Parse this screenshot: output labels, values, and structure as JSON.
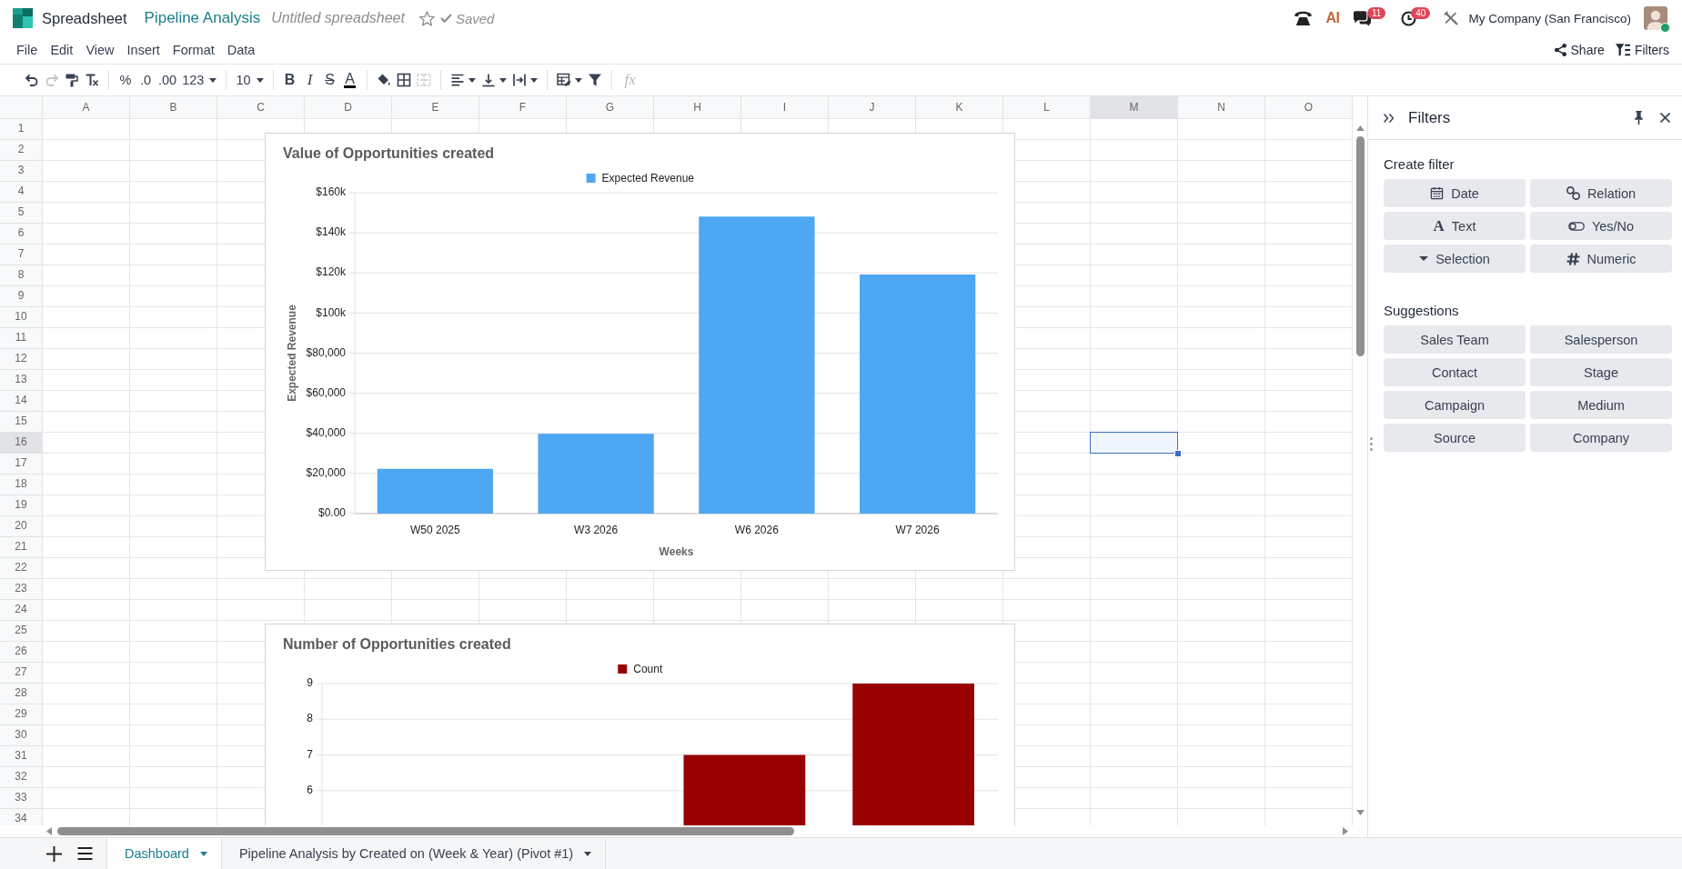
{
  "navbar": {
    "app_name": "Spreadsheet",
    "breadcrumb": "Pipeline Analysis",
    "document_name": "Untitled spreadsheet",
    "starred": false,
    "save_status": "Saved",
    "ai_label": "AI",
    "chat_badge": "11",
    "activity_badge": "40",
    "company": "My Company (San Francisco)",
    "user_online": true
  },
  "menubar": {
    "menus": [
      "File",
      "Edit",
      "View",
      "Insert",
      "Format",
      "Data"
    ],
    "actions": [
      "Share",
      "Filters"
    ]
  },
  "toolbar": [
    [
      {
        "kind": "icon",
        "disabled": false
      },
      {
        "kind": "icon",
        "disabled": true
      },
      {
        "kind": "icon",
        "disabled": false
      },
      {
        "kind": "icon",
        "disabled": false
      }
    ],
    [
      {
        "kind": "text",
        "label": "%",
        "disabled": false
      },
      {
        "kind": "text",
        "label": ".0",
        "disabled": false
      },
      {
        "kind": "text",
        "label": ".00",
        "disabled": false
      },
      {
        "kind": "menu",
        "label": "123",
        "disabled": false
      }
    ],
    [
      {
        "kind": "menu",
        "label": "10",
        "disabled": false
      }
    ],
    [
      {
        "kind": "bold",
        "label": "B",
        "disabled": false
      },
      {
        "kind": "italic",
        "label": "I",
        "disabled": false
      },
      {
        "kind": "strike",
        "label": "S",
        "disabled": false
      },
      {
        "kind": "color",
        "label": "A",
        "disabled": false
      }
    ],
    [
      {
        "kind": "icon",
        "disabled": false
      },
      {
        "kind": "icon",
        "disabled": false
      },
      {
        "kind": "icon",
        "disabled": true
      }
    ],
    [
      {
        "kind": "iconmenu",
        "disabled": false
      },
      {
        "kind": "iconmenu",
        "disabled": false
      },
      {
        "kind": "iconmenu",
        "disabled": false
      }
    ],
    [
      {
        "kind": "iconmenu",
        "disabled": false
      },
      {
        "kind": "icon",
        "disabled": false
      }
    ]
  ],
  "formula_bar": {
    "label": "fx"
  },
  "grid": {
    "columns": [
      {
        "label": "A",
        "selected": false
      },
      {
        "label": "B",
        "selected": false
      },
      {
        "label": "C",
        "selected": false
      },
      {
        "label": "D",
        "selected": false
      },
      {
        "label": "E",
        "selected": false
      },
      {
        "label": "F",
        "selected": false
      },
      {
        "label": "G",
        "selected": false
      },
      {
        "label": "H",
        "selected": false
      },
      {
        "label": "I",
        "selected": false
      },
      {
        "label": "J",
        "selected": false
      },
      {
        "label": "K",
        "selected": false
      },
      {
        "label": "L",
        "selected": false
      },
      {
        "label": "M",
        "selected": true
      },
      {
        "label": "N",
        "selected": false
      },
      {
        "label": "O",
        "selected": false
      }
    ],
    "rows": [
      {
        "label": "1",
        "selected": false
      },
      {
        "label": "2",
        "selected": false
      },
      {
        "label": "3",
        "selected": false
      },
      {
        "label": "4",
        "selected": false
      },
      {
        "label": "5",
        "selected": false
      },
      {
        "label": "6",
        "selected": false
      },
      {
        "label": "7",
        "selected": false
      },
      {
        "label": "8",
        "selected": false
      },
      {
        "label": "9",
        "selected": false
      },
      {
        "label": "10",
        "selected": false
      },
      {
        "label": "11",
        "selected": false
      },
      {
        "label": "12",
        "selected": false
      },
      {
        "label": "13",
        "selected": false
      },
      {
        "label": "14",
        "selected": false
      },
      {
        "label": "15",
        "selected": false
      },
      {
        "label": "16",
        "selected": true
      },
      {
        "label": "17",
        "selected": false
      },
      {
        "label": "18",
        "selected": false
      },
      {
        "label": "19",
        "selected": false
      },
      {
        "label": "20",
        "selected": false
      },
      {
        "label": "21",
        "selected": false
      },
      {
        "label": "22",
        "selected": false
      },
      {
        "label": "23",
        "selected": false
      },
      {
        "label": "24",
        "selected": false
      },
      {
        "label": "25",
        "selected": false
      },
      {
        "label": "26",
        "selected": false
      },
      {
        "label": "27",
        "selected": false
      },
      {
        "label": "28",
        "selected": false
      },
      {
        "label": "29",
        "selected": false
      },
      {
        "label": "30",
        "selected": false
      },
      {
        "label": "31",
        "selected": false
      },
      {
        "label": "32",
        "selected": false
      },
      {
        "label": "33",
        "selected": false
      },
      {
        "label": "34",
        "selected": false
      }
    ]
  },
  "charts": [
    {
      "chart_data": {
        "type": "bar",
        "title": "Value of Opportunities created",
        "xlabel": "Weeks",
        "ylabel": "Expected Revenue",
        "categories": [
          "W50 2025",
          "W3 2026",
          "W6 2026",
          "W7 2026"
        ],
        "series": [
          {
            "name": "Expected Revenue",
            "color": "#4ea7f2",
            "values": [
              22300,
              39800,
              148100,
              119200
            ]
          }
        ],
        "ylim": [
          0,
          160000
        ],
        "yticks": [
          {
            "value": 0,
            "label": "$0.00"
          },
          {
            "value": 20000,
            "label": "$20,000"
          },
          {
            "value": 40000,
            "label": "$40,000"
          },
          {
            "value": 60000,
            "label": "$60,000"
          },
          {
            "value": 80000,
            "label": "$80,000"
          },
          {
            "value": 100000,
            "label": "$100k"
          },
          {
            "value": 120000,
            "label": "$120k"
          },
          {
            "value": 140000,
            "label": "$140k"
          },
          {
            "value": 160000,
            "label": "$160k"
          }
        ],
        "grid": true
      }
    },
    {
      "chart_data": {
        "type": "bar",
        "title": "Number of Opportunities created",
        "series": [
          {
            "name": "Count",
            "color": "#990000",
            "values": [
              null,
              null,
              7,
              9
            ]
          }
        ],
        "ylim": [
          5,
          9
        ],
        "yticks": [
          6,
          7,
          8,
          9
        ],
        "grid": true
      }
    }
  ],
  "filters_panel": {
    "title": "Filters",
    "create_label": "Create filter",
    "create_buttons": [
      {
        "label": "Date"
      },
      {
        "label": "Relation"
      },
      {
        "label": "Text",
        "glyph": "A"
      },
      {
        "label": "Yes/No"
      },
      {
        "label": "Selection"
      },
      {
        "label": "Numeric"
      }
    ],
    "suggestions_label": "Suggestions",
    "suggestions": [
      "Sales Team",
      "Salesperson",
      "Contact",
      "Stage",
      "Campaign",
      "Medium",
      "Source",
      "Company"
    ]
  },
  "sheet_tabs": [
    {
      "label": "Dashboard",
      "selected": true
    },
    {
      "label": "Pipeline Analysis by Created on (Week & Year) (Pivot #1)",
      "selected": false
    }
  ]
}
